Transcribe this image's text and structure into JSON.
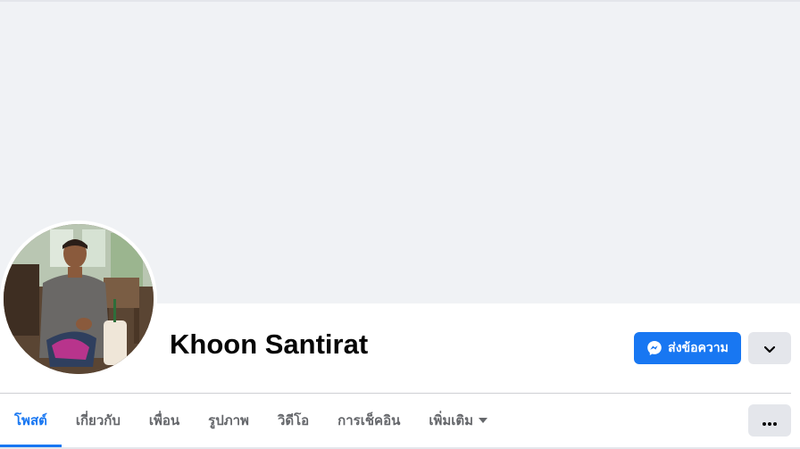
{
  "profile": {
    "name": "Khoon Santirat"
  },
  "actions": {
    "message_label": "ส่งข้อความ",
    "message_icon": "messenger-icon",
    "dropdown_icon": "chevron-down-icon"
  },
  "tabs": [
    {
      "label": "โพสต์",
      "active": true
    },
    {
      "label": "เกี่ยวกับ",
      "active": false
    },
    {
      "label": "เพื่อน",
      "active": false
    },
    {
      "label": "รูปภาพ",
      "active": false
    },
    {
      "label": "วิดีโอ",
      "active": false
    },
    {
      "label": "การเช็คอิน",
      "active": false
    },
    {
      "label": "เพิ่มเติม",
      "active": false
    }
  ],
  "more_options_icon": "more-horizontal-icon",
  "colors": {
    "accent": "#1877f2",
    "cover": "#f0f2f5",
    "button_gray": "#e4e6eb",
    "text_primary": "#050505",
    "text_secondary": "#65676b"
  }
}
